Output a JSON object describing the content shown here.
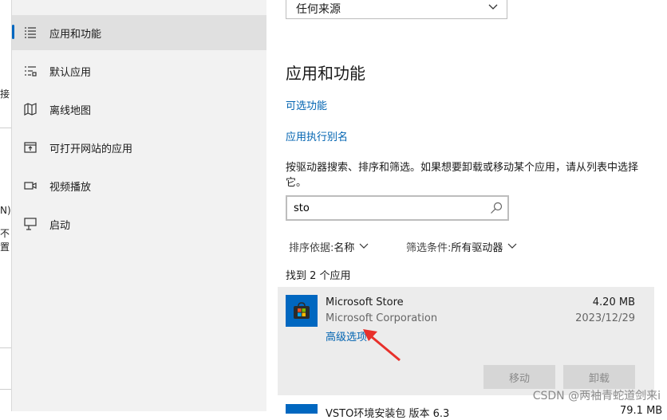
{
  "edge_fragments": [
    "接",
    "N)",
    "不",
    "置"
  ],
  "sidebar": {
    "items": [
      {
        "label": "应用和功能",
        "icon": "apps-list-icon",
        "active": true
      },
      {
        "label": "默认应用",
        "icon": "default-apps-icon",
        "active": false
      },
      {
        "label": "离线地图",
        "icon": "map-icon",
        "active": false
      },
      {
        "label": "可打开网站的应用",
        "icon": "open-website-icon",
        "active": false
      },
      {
        "label": "视频播放",
        "icon": "video-icon",
        "active": false
      },
      {
        "label": "启动",
        "icon": "startup-icon",
        "active": false
      }
    ]
  },
  "main": {
    "source_select": {
      "value": "任何来源"
    },
    "title": "应用和功能",
    "links": {
      "optional_features": "可选功能",
      "app_aliases": "应用执行别名"
    },
    "description": "按驱动器搜索、排序和筛选。如果想要卸载或移动某个应用，请从列表中选择它。",
    "search": {
      "value": "sto"
    },
    "sort": {
      "label": "排序依据: ",
      "value": "名称"
    },
    "filter": {
      "label": "筛选条件: ",
      "value": "所有驱动器"
    },
    "found_text": "找到 2 个应用",
    "app": {
      "name": "Microsoft Store",
      "publisher": "Microsoft Corporation",
      "size": "4.20 MB",
      "date": "2023/12/29",
      "advanced": "高级选项",
      "move_button": "移动",
      "uninstall_button": "卸载"
    },
    "next_app": {
      "name": "VSTO环境安装包 版本 6.3",
      "size": "79.1 MB"
    }
  },
  "watermark": "CSDN @两袖青蛇道剑来i",
  "colors": {
    "accent": "#0067c0",
    "link": "#0063b1",
    "arrow": "#e8302b",
    "sidebar_bg": "#f2f2f2"
  }
}
